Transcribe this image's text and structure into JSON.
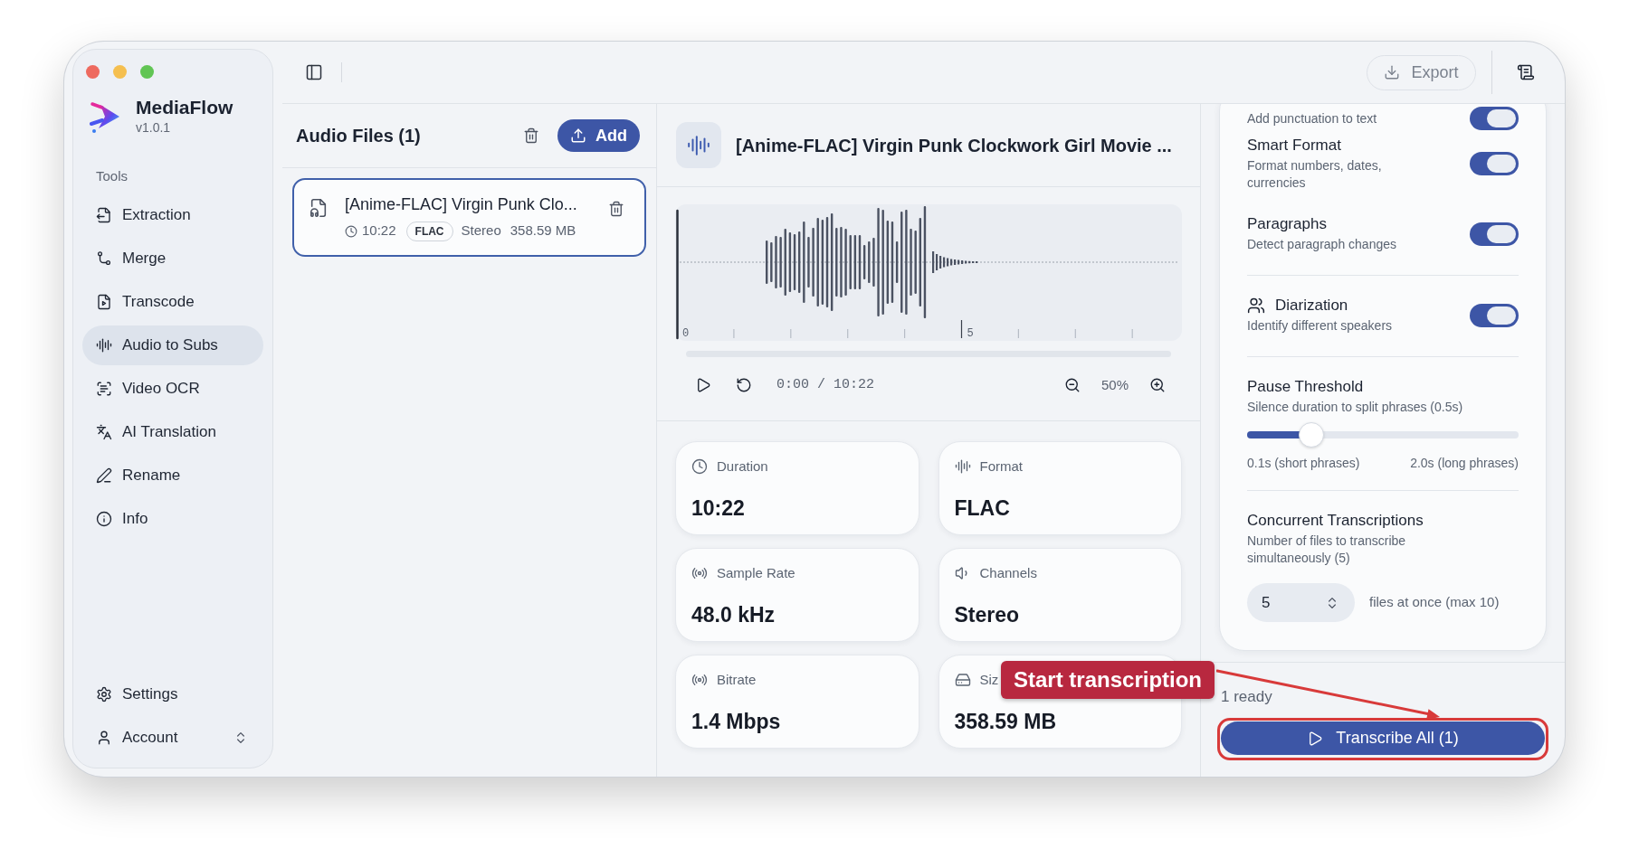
{
  "sidebar": {
    "app_name": "MediaFlow",
    "version": "v1.0.1",
    "section_label": "Tools",
    "items": [
      {
        "label": "Extraction",
        "selected": false
      },
      {
        "label": "Merge",
        "selected": false
      },
      {
        "label": "Transcode",
        "selected": false
      },
      {
        "label": "Audio to Subs",
        "selected": true
      },
      {
        "label": "Video OCR",
        "selected": false
      },
      {
        "label": "AI Translation",
        "selected": false
      },
      {
        "label": "Rename",
        "selected": false
      },
      {
        "label": "Info",
        "selected": false
      }
    ],
    "footer_items": [
      {
        "label": "Settings",
        "kind": "link"
      },
      {
        "label": "Account",
        "kind": "menu"
      }
    ]
  },
  "toolbar": {
    "export_label": "Export"
  },
  "audio_files": {
    "title": "Audio Files (1)",
    "add_label": "Add",
    "files": [
      {
        "name": "[Anime-FLAC] Virgin Punk Clo...",
        "duration": "10:22",
        "format": "FLAC",
        "channels": "Stereo",
        "size": "358.59 MB",
        "selected": true
      }
    ]
  },
  "player": {
    "title": "[Anime-FLAC] Virgin Punk Clockwork Girl Movie ...",
    "timeline_labels": [
      "0",
      "5"
    ],
    "time": "0:00 / 10:22",
    "zoom": "50%"
  },
  "info_cards": [
    {
      "label": "Duration",
      "value": "10:22"
    },
    {
      "label": "Format",
      "value": "FLAC"
    },
    {
      "label": "Sample Rate",
      "value": "48.0 kHz"
    },
    {
      "label": "Channels",
      "value": "Stereo"
    },
    {
      "label": "Bitrate",
      "value": "1.4 Mbps"
    },
    {
      "label": "Siz",
      "value": "358.59 MB"
    }
  ],
  "settings": {
    "sections": [
      {
        "items": [
          {
            "kind": "toggle",
            "description": "Add punctuation to text",
            "on": true
          },
          {
            "kind": "toggle",
            "title": "Smart Format",
            "description": "Format numbers, dates, currencies",
            "on": true
          },
          {
            "kind": "toggle",
            "title": "Paragraphs",
            "description": "Detect paragraph changes",
            "on": true
          }
        ]
      },
      {
        "items": [
          {
            "kind": "toggle",
            "title": "Diarization",
            "description": "Identify different speakers",
            "on": true
          }
        ]
      },
      {
        "items": [
          {
            "kind": "slider",
            "title": "Pause Threshold",
            "description": "Silence duration to split phrases (0.5s)",
            "level": 0.21,
            "min_label": "0.1s (short phrases)",
            "max_label": "2.0s (long phrases)"
          }
        ]
      },
      {
        "items": [
          {
            "kind": "number",
            "title": "Concurrent Transcriptions",
            "description": "Number of files to transcribe simultaneously (5)",
            "value": "5",
            "suffix": "files at once (max 10)"
          }
        ]
      }
    ]
  },
  "footer": {
    "status": "1 ready",
    "action_label": "Transcribe All (1)"
  },
  "annotation": {
    "text": "Start transcription"
  }
}
